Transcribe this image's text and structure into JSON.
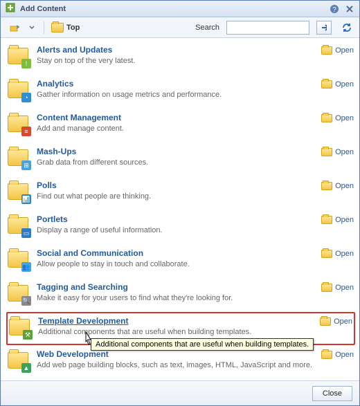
{
  "title": "Add Content",
  "toolbar": {
    "breadcrumb_label": "Top",
    "search_label": "Search",
    "search_value": "",
    "search_placeholder": ""
  },
  "open_label": "Open",
  "items": [
    {
      "title": "Alerts and Updates",
      "desc": "Stay on top of the very latest.",
      "badge_bg": "#7bbf3c",
      "badge_glyph": "!"
    },
    {
      "title": "Analytics",
      "desc": "Gather information on usage metrics and performance.",
      "badge_bg": "#2e8fd6",
      "badge_glyph": "◔"
    },
    {
      "title": "Content Management",
      "desc": "Add and manage content.",
      "badge_bg": "#d64a2e",
      "badge_glyph": "≡"
    },
    {
      "title": "Mash-Ups",
      "desc": "Grab data from different sources.",
      "badge_bg": "#4aa3df",
      "badge_glyph": "⊞"
    },
    {
      "title": "Polls",
      "desc": "Find out what people are thinking.",
      "badge_bg": "#3a7fc2",
      "badge_glyph": "📊"
    },
    {
      "title": "Portlets",
      "desc": "Display a range of useful information.",
      "badge_bg": "#2e7cc7",
      "badge_glyph": "▭"
    },
    {
      "title": "Social and Communication",
      "desc": "Allow people to stay in touch and collaborate.",
      "badge_bg": "#4aa3df",
      "badge_glyph": "👥"
    },
    {
      "title": "Tagging and Searching",
      "desc": "Make it easy for your users to find what they're looking for.",
      "badge_bg": "#8a8a8a",
      "badge_glyph": "🔍"
    },
    {
      "title": "Template Development",
      "desc": "Additional components that are useful when building templates.",
      "badge_bg": "#5aa33a",
      "badge_glyph": "⚒",
      "highlighted": true,
      "tooltip": "Additional components that are useful when building templates."
    },
    {
      "title": "Web Development",
      "desc": "Add web page building blocks, such as text, images, HTML, JavaScript and more.",
      "badge_bg": "#3aa35a",
      "badge_glyph": "▲"
    }
  ],
  "footer": {
    "close_label": "Close"
  }
}
